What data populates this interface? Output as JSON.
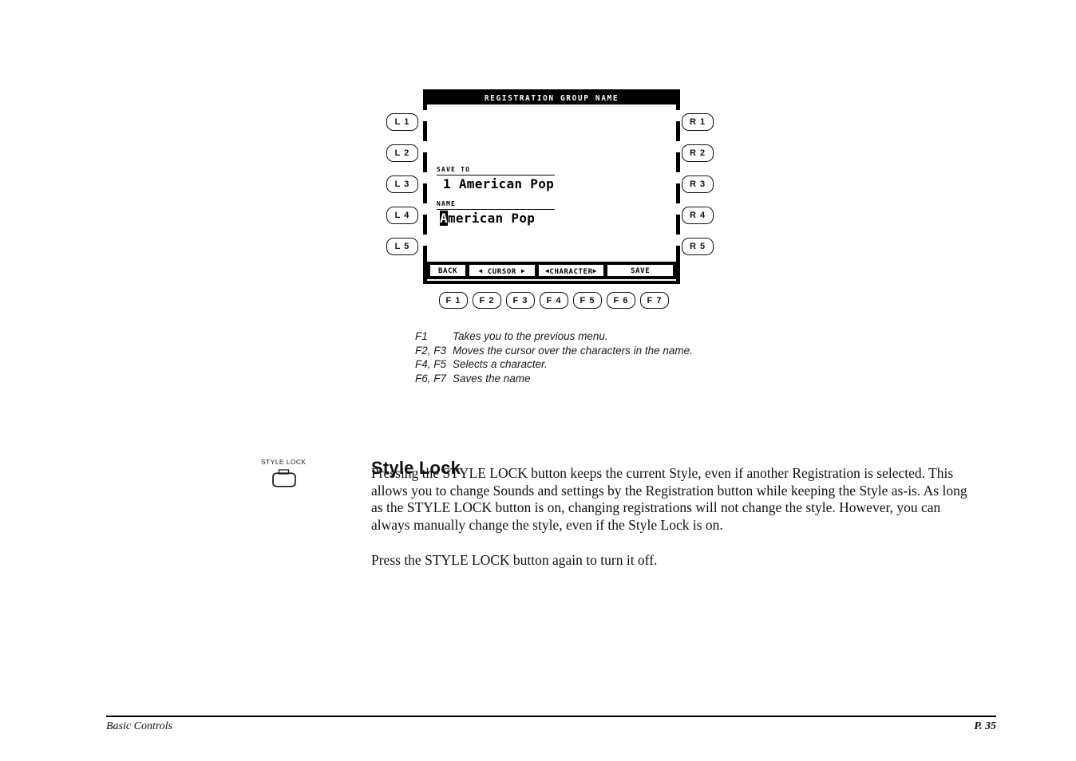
{
  "device_panel": {
    "left_buttons": [
      "L 1",
      "L 2",
      "L 3",
      "L 4",
      "L 5"
    ],
    "right_buttons": [
      "R 1",
      "R 2",
      "R 3",
      "R 4",
      "R 5"
    ],
    "function_buttons": [
      "F 1",
      "F 2",
      "F 3",
      "F 4",
      "F 5",
      "F 6",
      "F 7"
    ],
    "lcd": {
      "title": "REGISTRATION GROUP NAME",
      "fields": [
        {
          "label": "SAVE TO",
          "value": "1 American Pop",
          "cursor_char": "",
          "value_rest": ""
        },
        {
          "label": "NAME",
          "value": "American Pop",
          "cursor_char": "A",
          "value_rest": "merican Pop"
        }
      ],
      "softkeys": [
        {
          "id": "back",
          "label": "BACK",
          "left_arrow": "",
          "right_arrow": ""
        },
        {
          "id": "cursor",
          "label": "CURSOR",
          "left_arrow": "◀",
          "right_arrow": "▶"
        },
        {
          "id": "character",
          "label": "CHARACTER",
          "left_arrow": "◀",
          "right_arrow": "▶"
        },
        {
          "id": "save",
          "label": "SAVE",
          "left_arrow": "",
          "right_arrow": ""
        }
      ]
    }
  },
  "fkey_legend": [
    {
      "keys": "F1",
      "desc": "Takes you to the previous menu."
    },
    {
      "keys": "F2, F3",
      "desc": "Moves the cursor over the characters in the name."
    },
    {
      "keys": "F4, F5",
      "desc": "Selects a character."
    },
    {
      "keys": "F6, F7",
      "desc": "Saves the name"
    }
  ],
  "style_lock": {
    "button_caption": "STYLE LOCK",
    "heading": "Style Lock",
    "paragraph1": "Pressing the STYLE LOCK button keeps the current Style, even if another Registration is selected. This allows you to change Sounds and settings by the Registration button while keeping the Style as-is.  As long as the STYLE LOCK button is on, changing registrations will not change the style. However, you can always manually change the style, even if the Style Lock is on.",
    "paragraph2": "Press the STYLE LOCK button again to turn it off."
  },
  "footer": {
    "section": "Basic Controls",
    "page": "P. 35"
  },
  "colors": {
    "ink": "#000000",
    "paper": "#ffffff"
  }
}
